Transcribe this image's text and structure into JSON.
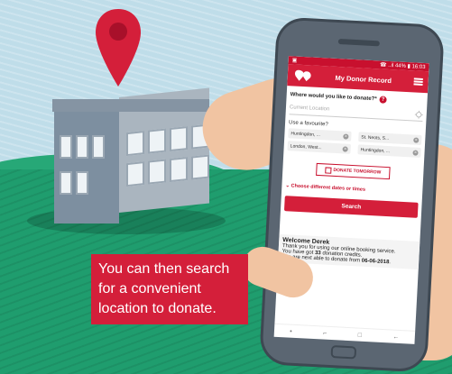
{
  "caption": {
    "line1": "You can then search",
    "line2": "for a convenient",
    "line3": "location to donate."
  },
  "status_bar": {
    "left": "▣",
    "right": "☎ ..il 44% ▮ 16:03"
  },
  "app": {
    "title": "My Donor Record"
  },
  "question": {
    "label": "Where would you like to donate?*",
    "help": "?"
  },
  "location_input": {
    "placeholder": "Current Location"
  },
  "favourites": {
    "label": "Use a favourite?",
    "items": [
      {
        "label": "Huntingdon, ..."
      },
      {
        "label": "St. Neots, S..."
      },
      {
        "label": "London, West..."
      },
      {
        "label": "Huntingdon, ..."
      }
    ]
  },
  "donate_tomorrow": {
    "label": "DONATE TOMORROW"
  },
  "different_dates": {
    "label": "Choose different dates or times"
  },
  "search_button": {
    "label": "Search"
  },
  "welcome": {
    "title": "Welcome Derek",
    "line1": "Thank you for using our online booking service.",
    "line2_prefix": "You have got ",
    "credits": "33",
    "line2_suffix": " donation credits.",
    "line3_prefix": "You are next able to donate from ",
    "date": "06-06-2018",
    "line3_suffix": "."
  },
  "colors": {
    "brand_red": "#d41f3a",
    "grass": "#1f9d6e",
    "sky": "#bfdde9"
  },
  "icons": [
    "map-pin-icon",
    "location-target-icon",
    "close-icon",
    "checkbox-icon",
    "chevron-down-icon",
    "menu-icon",
    "logo-icon"
  ]
}
